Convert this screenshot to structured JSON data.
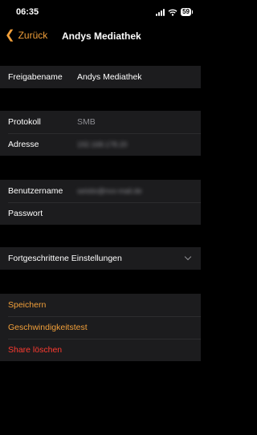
{
  "status": {
    "time": "06:35",
    "battery": "59"
  },
  "nav": {
    "back_label": "Zurück",
    "title": "Andys Mediathek"
  },
  "share": {
    "name_label": "Freigabename",
    "name_value": "Andys Mediathek"
  },
  "connection": {
    "protocol_label": "Protokoll",
    "protocol_value": "SMB",
    "address_label": "Adresse",
    "address_value": "192.168.178.20"
  },
  "credentials": {
    "username_label": "Benutzername",
    "username_value": "seistio@nvx-mail.de",
    "password_label": "Passwort"
  },
  "advanced": {
    "label": "Fortgeschrittene Einstellungen"
  },
  "actions": {
    "save": "Speichern",
    "speed_test": "Geschwindigkeitstest",
    "delete": "Share löschen"
  },
  "colors": {
    "accent": "#f2a03a",
    "destructive": "#ff3b30",
    "cell": "#1c1c1e"
  }
}
